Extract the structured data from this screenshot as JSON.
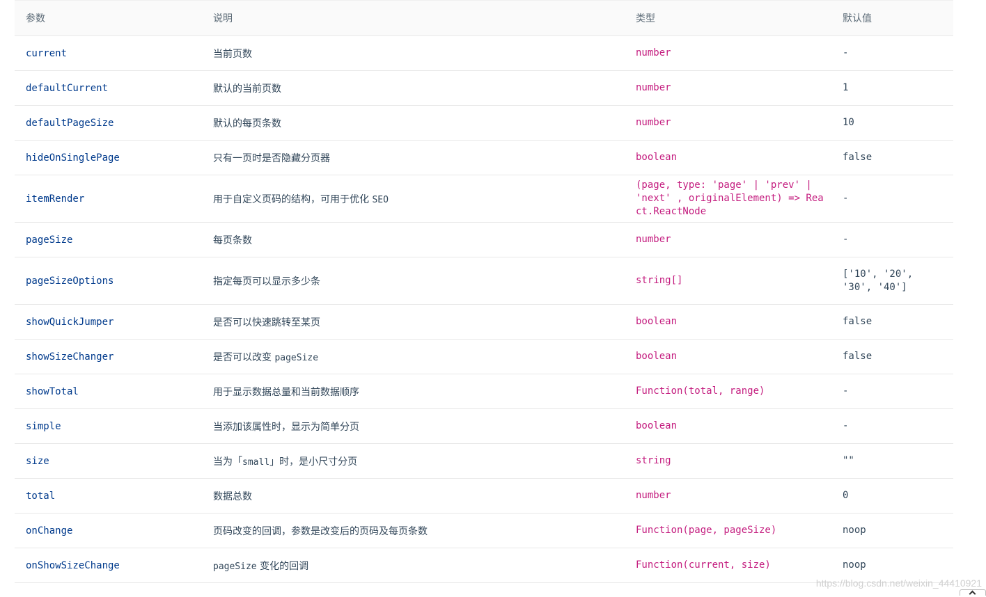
{
  "table": {
    "headers": [
      "参数",
      "说明",
      "类型",
      "默认值"
    ],
    "rows": [
      {
        "param": "current",
        "desc_text": "当前页数",
        "desc_code": "",
        "desc_suffix": "",
        "type": "number",
        "default": "-"
      },
      {
        "param": "defaultCurrent",
        "desc_text": "默认的当前页数",
        "desc_code": "",
        "desc_suffix": "",
        "type": "number",
        "default": "1"
      },
      {
        "param": "defaultPageSize",
        "desc_text": "默认的每页条数",
        "desc_code": "",
        "desc_suffix": "",
        "type": "number",
        "default": "10"
      },
      {
        "param": "hideOnSinglePage",
        "desc_text": "只有一页时是否隐藏分页器",
        "desc_code": "",
        "desc_suffix": "",
        "type": "boolean",
        "default": "false"
      },
      {
        "param": "itemRender",
        "desc_text": "用于自定义页码的结构，可用于优化 ",
        "desc_code": "SEO",
        "desc_suffix": "",
        "type": "(page, type: 'page' | 'prev' | 'next' , originalElement) => React.ReactNode",
        "default": "-"
      },
      {
        "param": "pageSize",
        "desc_text": "每页条数",
        "desc_code": "",
        "desc_suffix": "",
        "type": "number",
        "default": "-"
      },
      {
        "param": "pageSizeOptions",
        "desc_text": "指定每页可以显示多少条",
        "desc_code": "",
        "desc_suffix": "",
        "type": "string[]",
        "default": "['10', '20', '30', '40']"
      },
      {
        "param": "showQuickJumper",
        "desc_text": "是否可以快速跳转至某页",
        "desc_code": "",
        "desc_suffix": "",
        "type": "boolean",
        "default": "false"
      },
      {
        "param": "showSizeChanger",
        "desc_text": "是否可以改变 ",
        "desc_code": "pageSize",
        "desc_suffix": "",
        "type": "boolean",
        "default": "false"
      },
      {
        "param": "showTotal",
        "desc_text": "用于显示数据总量和当前数据顺序",
        "desc_code": "",
        "desc_suffix": "",
        "type": "Function(total, range)",
        "default": "-"
      },
      {
        "param": "simple",
        "desc_text": "当添加该属性时，显示为简单分页",
        "desc_code": "",
        "desc_suffix": "",
        "type": "boolean",
        "default": "-"
      },
      {
        "param": "size",
        "desc_text": "当为「",
        "desc_code": "small",
        "desc_suffix": "」时，是小尺寸分页",
        "type": "string",
        "default": "\"\""
      },
      {
        "param": "total",
        "desc_text": "数据总数",
        "desc_code": "",
        "desc_suffix": "",
        "type": "number",
        "default": "0"
      },
      {
        "param": "onChange",
        "desc_text": "页码改变的回调，参数是改变后的页码及每页条数",
        "desc_code": "",
        "desc_suffix": "",
        "type": "Function(page, pageSize)",
        "default": "noop"
      },
      {
        "param": "onShowSizeChange",
        "desc_text": "",
        "desc_code": "pageSize",
        "desc_suffix": " 变化的回调",
        "type": "Function(current, size)",
        "default": "noop"
      }
    ]
  },
  "watermark": "https://blog.csdn.net/weixin_44410921"
}
